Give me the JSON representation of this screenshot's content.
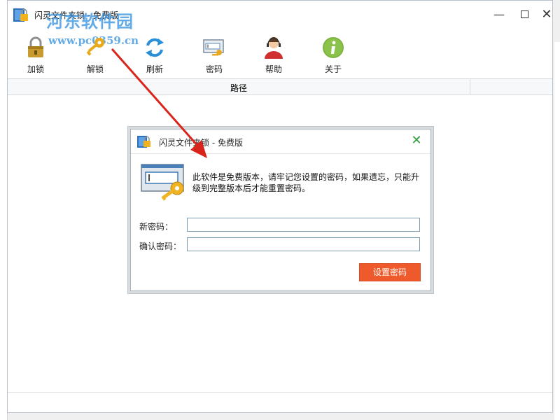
{
  "window": {
    "title": "闪灵文件夹锁 - 免费版",
    "minimize_glyph": "—",
    "close_glyph": "✕"
  },
  "watermark": {
    "name": "河东软件园",
    "url": "www.pc0359.cn"
  },
  "toolbar": {
    "items": [
      {
        "label": "加锁",
        "icon": "lock-icon"
      },
      {
        "label": "解锁",
        "icon": "key-icon"
      },
      {
        "label": "刷新",
        "icon": "refresh-icon"
      },
      {
        "label": "密码",
        "icon": "password-icon"
      },
      {
        "label": "帮助",
        "icon": "support-agent-icon"
      },
      {
        "label": "关于",
        "icon": "info-icon"
      }
    ]
  },
  "table": {
    "columns": [
      "路径"
    ]
  },
  "dialog": {
    "title": "闪灵文件夹锁 - 免费版",
    "message": "此软件是免费版本，请牢记您设置的密码，如果遗忘，只能升级到完整版本后才能重置密码。",
    "new_password_label": "新密码：",
    "new_password_value": "",
    "confirm_password_label": "确认密码：",
    "confirm_password_value": "",
    "submit_label": "设置密码",
    "close_glyph": "✕"
  },
  "colors": {
    "accent_button": "#ef5a2c",
    "close_green": "#2e9c3b",
    "annotation_arrow": "#d9241c",
    "watermark_blue": "#2f8fe0"
  }
}
